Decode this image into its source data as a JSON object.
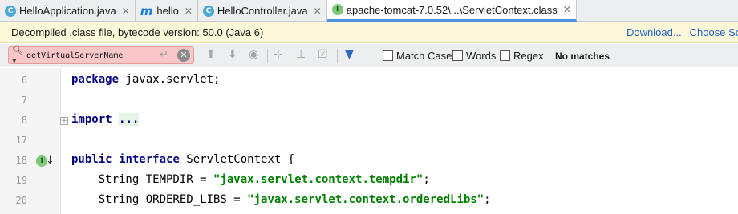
{
  "tabs": [
    {
      "label": "HelloApplication.java",
      "icon": "class-spring-icon",
      "active": false
    },
    {
      "label": "hello",
      "icon": "m-file-icon",
      "active": false
    },
    {
      "label": "HelloController.java",
      "icon": "class-icon",
      "active": false
    },
    {
      "label": "apache-tomcat-7.0.52\\...\\ServletContext.class",
      "icon": "interface-icon",
      "active": true
    }
  ],
  "banner": {
    "text": "Decompiled .class file, bytecode version: 50.0 (Java 6)",
    "download_link": "Download...",
    "choose_source_link": "Choose Sour"
  },
  "search": {
    "value": "getVirtualServerName",
    "match_case_label": "Match Case",
    "words_label": "Words",
    "regex_label": "Regex",
    "status": "No matches"
  },
  "editor": {
    "lines": [
      {
        "number": "6",
        "parts": [
          {
            "t": "package",
            "c": "kw"
          },
          {
            "t": " javax.servlet;",
            "c": ""
          }
        ]
      },
      {
        "number": "7",
        "parts": []
      },
      {
        "number": "8",
        "parts": [
          {
            "t": "import",
            "c": "kw"
          },
          {
            "t": " ",
            "c": ""
          },
          {
            "t": "...",
            "c": "folded"
          }
        ]
      },
      {
        "number": "17",
        "parts": []
      },
      {
        "number": "18",
        "parts": [
          {
            "t": "public",
            "c": "kw"
          },
          {
            "t": " ",
            "c": ""
          },
          {
            "t": "interface",
            "c": "kw"
          },
          {
            "t": " ServletContext {",
            "c": ""
          }
        ]
      },
      {
        "number": "19",
        "parts": [
          {
            "t": "    String TEMPDIR = ",
            "c": ""
          },
          {
            "t": "\"javax.servlet.context.tempdir\"",
            "c": "str"
          },
          {
            "t": ";",
            "c": ""
          }
        ]
      },
      {
        "number": "20",
        "parts": [
          {
            "t": "    String ORDERED_LIBS = ",
            "c": ""
          },
          {
            "t": "\"javax.servlet.context.orderedLibs\"",
            "c": "str"
          },
          {
            "t": ";",
            "c": ""
          }
        ]
      }
    ]
  }
}
